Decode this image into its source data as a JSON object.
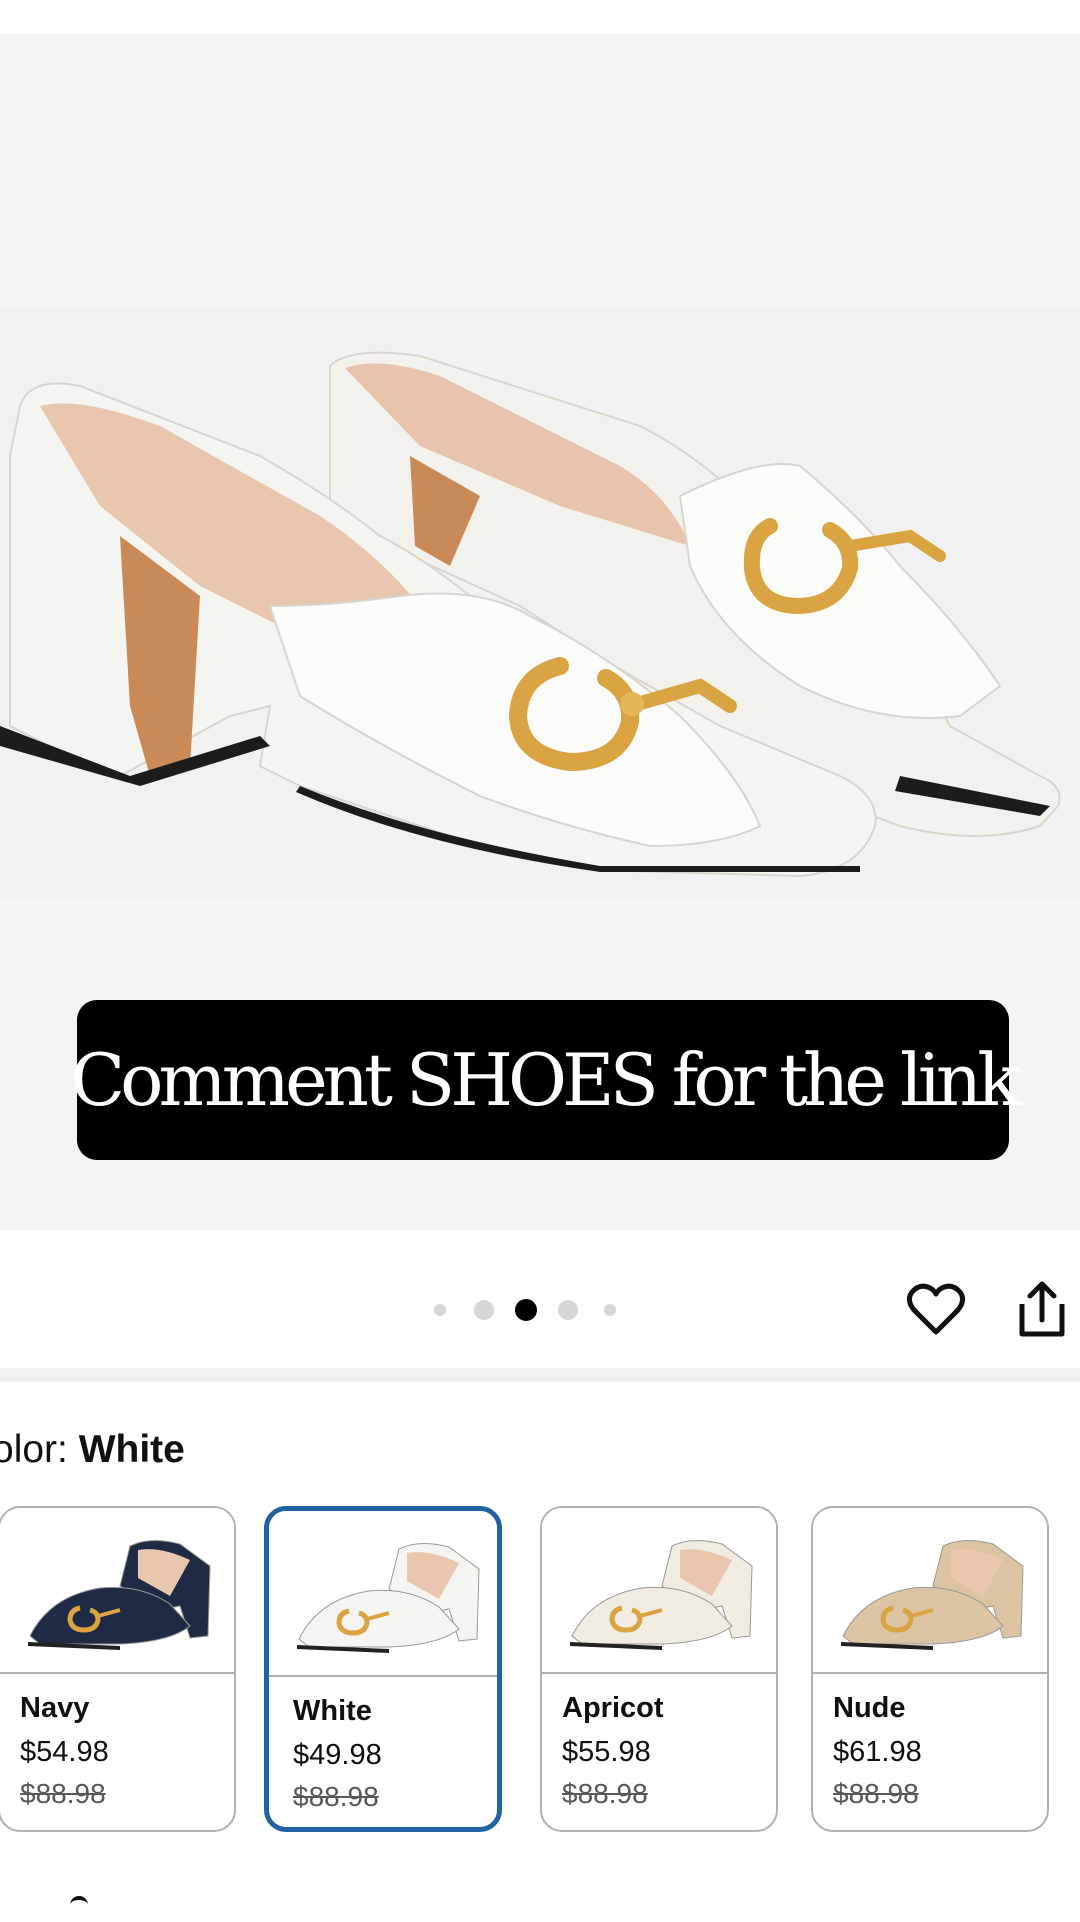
{
  "caption": "Comment SHOES for the link",
  "carousel": {
    "count": 5,
    "active_index": 2
  },
  "actions": {
    "favorite_icon": "heart-outline-icon",
    "share_icon": "share-icon"
  },
  "color": {
    "label": "olor:",
    "selected": "White"
  },
  "swatches": [
    {
      "name": "Navy",
      "price": "$54.98",
      "list_price": "$88.98",
      "tint": "#1f2a44"
    },
    {
      "name": "White",
      "price": "$49.98",
      "list_price": "$88.98",
      "tint": "#f4f4f1"
    },
    {
      "name": "Apricot",
      "price": "$55.98",
      "list_price": "$88.98",
      "tint": "#f1ece2"
    },
    {
      "name": "Nude",
      "price": "$61.98",
      "list_price": "$88.98",
      "tint": "#dcc3a4"
    }
  ],
  "colors": {
    "accent": "#2162a1",
    "caption_bg": "#000000",
    "gold": "#d9a441"
  }
}
